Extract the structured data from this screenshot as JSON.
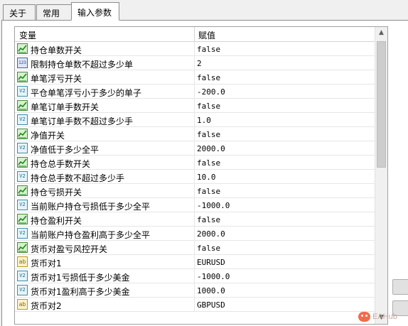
{
  "tabs": [
    {
      "label": "关于"
    },
    {
      "label": "常用"
    },
    {
      "label": "输入参数",
      "active": true
    }
  ],
  "grid": {
    "columns": {
      "variable": "变量",
      "value": "赋值"
    },
    "rows": [
      {
        "type": "bool",
        "icon": "boolean-icon",
        "name": "持仓单数开关",
        "value": "false"
      },
      {
        "type": "int",
        "icon": "integer-icon",
        "icon_text": "123",
        "name": "限制持仓单数不超过多少单",
        "value": "2"
      },
      {
        "type": "bool",
        "icon": "boolean-icon",
        "name": "单笔浮亏开关",
        "value": "false"
      },
      {
        "type": "dbl",
        "icon": "double-icon",
        "icon_text": "V2",
        "name": "平仓单笔浮亏小于多少的单子",
        "value": "-200.0"
      },
      {
        "type": "bool",
        "icon": "boolean-icon",
        "name": "单笔订单手数开关",
        "value": "false"
      },
      {
        "type": "dbl",
        "icon": "double-icon",
        "icon_text": "V2",
        "name": "单笔订单手数不超过多少手",
        "value": "1.0"
      },
      {
        "type": "bool",
        "icon": "boolean-icon",
        "name": "净值开关",
        "value": "false"
      },
      {
        "type": "dbl",
        "icon": "double-icon",
        "icon_text": "V2",
        "name": "净值低于多少全平",
        "value": "2000.0"
      },
      {
        "type": "bool",
        "icon": "boolean-icon",
        "name": "持仓总手数开关",
        "value": "false"
      },
      {
        "type": "dbl",
        "icon": "double-icon",
        "icon_text": "V2",
        "name": "持仓总手数不超过多少手",
        "value": "10.0"
      },
      {
        "type": "bool",
        "icon": "boolean-icon",
        "name": "持仓亏损开关",
        "value": "false"
      },
      {
        "type": "dbl",
        "icon": "double-icon",
        "icon_text": "V2",
        "name": "当前账户持仓亏损低于多少全平",
        "value": "-1000.0"
      },
      {
        "type": "bool",
        "icon": "boolean-icon",
        "name": "持仓盈利开关",
        "value": "false"
      },
      {
        "type": "dbl",
        "icon": "double-icon",
        "icon_text": "V2",
        "name": "当前账户持仓盈利高于多少全平",
        "value": "2000.0"
      },
      {
        "type": "bool",
        "icon": "boolean-icon",
        "name": "货币对盈亏风控开关",
        "value": "false"
      },
      {
        "type": "str",
        "icon": "string-icon",
        "icon_text": "ab",
        "name": "货币对1",
        "value": "EURUSD"
      },
      {
        "type": "dbl",
        "icon": "double-icon",
        "icon_text": "V2",
        "name": "货币对1亏损低于多少美金",
        "value": "-1000.0"
      },
      {
        "type": "dbl",
        "icon": "double-icon",
        "icon_text": "V2",
        "name": "货币对1盈利高于多少美金",
        "value": "1000.0"
      },
      {
        "type": "str",
        "icon": "string-icon",
        "icon_text": "ab",
        "name": "货币对2",
        "value": "GBPUSD"
      }
    ]
  },
  "scrollbar": {
    "up": "▲",
    "down": "▼",
    "position": 0.0
  },
  "watermark": {
    "text": "EAHub"
  }
}
